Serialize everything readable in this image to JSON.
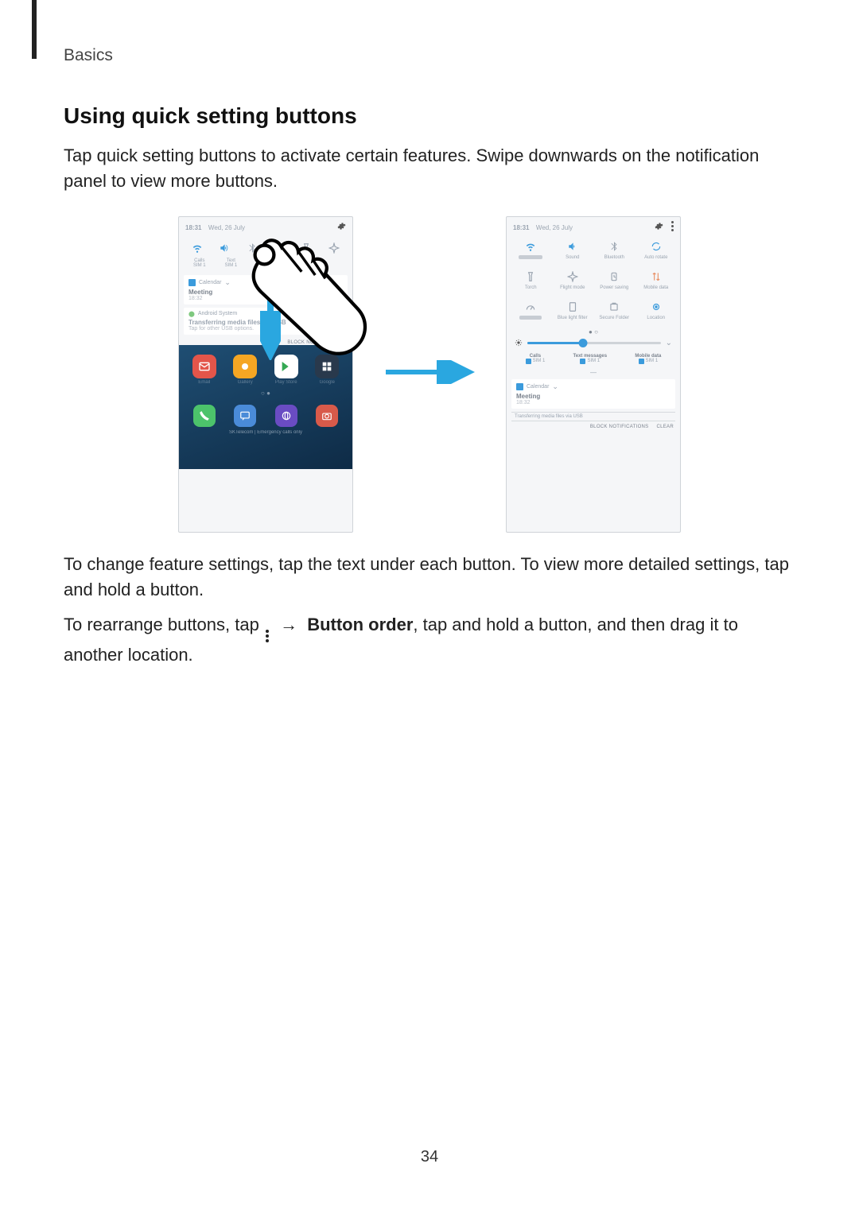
{
  "header": {
    "section": "Basics"
  },
  "h2": "Using quick setting buttons",
  "intro": "Tap quick setting buttons to activate certain features. Swipe downwards on the notification panel to view more buttons.",
  "after_figure_p1": "To change feature settings, tap the text under each button. To view more detailed settings, tap and hold a button.",
  "after_figure_p2_a": "To rearrange buttons, tap ",
  "after_figure_p2_arrow": "→",
  "after_figure_p2_bold": "Button order",
  "after_figure_p2_b": ", tap and hold a button, and then drag it to another location.",
  "status": {
    "time": "18:31",
    "date": "Wed, 26 July"
  },
  "collapsed_qs": [
    {
      "name": "wifi",
      "color": "#3b9bdc"
    },
    {
      "name": "sound",
      "color": "#3b9bdc"
    },
    {
      "name": "bluetooth",
      "color": "#9aa4b0"
    },
    {
      "name": "rotate",
      "color": "#3b9bdc"
    },
    {
      "name": "torch",
      "color": "#9aa4b0"
    },
    {
      "name": "airplane",
      "color": "#9aa4b0"
    }
  ],
  "collapsed_labels": [
    {
      "t": "Calls",
      "s": "SIM 1"
    },
    {
      "t": "Text",
      "s": "SIM 1"
    },
    {
      "t": "",
      "s": ""
    },
    {
      "t": "Mobile data",
      "s": ""
    }
  ],
  "notif1": {
    "app": "Calendar",
    "title": "Meeting",
    "sub": "18:32"
  },
  "notif2": {
    "app": "Android System",
    "title": "Transferring media files via USB",
    "sub": "Tap for other USB options."
  },
  "block_label": "BLOCK NOTIFICATIONS",
  "clear_label": "CLEAR",
  "expanded_qs": [
    {
      "name": "wifi",
      "label": "",
      "color": "#3b9bdc"
    },
    {
      "name": "sound",
      "label": "Sound",
      "color": "#3b9bdc"
    },
    {
      "name": "bluetooth",
      "label": "Bluetooth",
      "color": "#9aa4b0"
    },
    {
      "name": "rotate",
      "label": "Auto rotate",
      "color": "#3b9bdc"
    },
    {
      "name": "torch",
      "label": "Torch",
      "color": "#9aa4b0"
    },
    {
      "name": "airplane",
      "label": "Flight mode",
      "color": "#9aa4b0"
    },
    {
      "name": "powersave",
      "label": "Power saving",
      "color": "#9aa4b0"
    },
    {
      "name": "mobiledata",
      "label": "Mobile data",
      "color": "#e8936a"
    },
    {
      "name": "performance",
      "label": "",
      "color": "#9aa4b0"
    },
    {
      "name": "bluelight",
      "label": "Blue light filter",
      "color": "#9aa4b0"
    },
    {
      "name": "secure",
      "label": "Secure Folder",
      "color": "#9aa4b0"
    },
    {
      "name": "location",
      "label": "Location",
      "color": "#3b9bdc"
    }
  ],
  "sim_row": [
    {
      "t": "Calls",
      "s": "SIM 1"
    },
    {
      "t": "Text messages",
      "s": "SIM 1"
    },
    {
      "t": "Mobile data",
      "s": "SIM 1"
    }
  ],
  "expanded_notif": {
    "app": "Calendar",
    "title": "Meeting",
    "sub": "18:32",
    "line2": "Transferring media files via USB"
  },
  "page_number": "34"
}
